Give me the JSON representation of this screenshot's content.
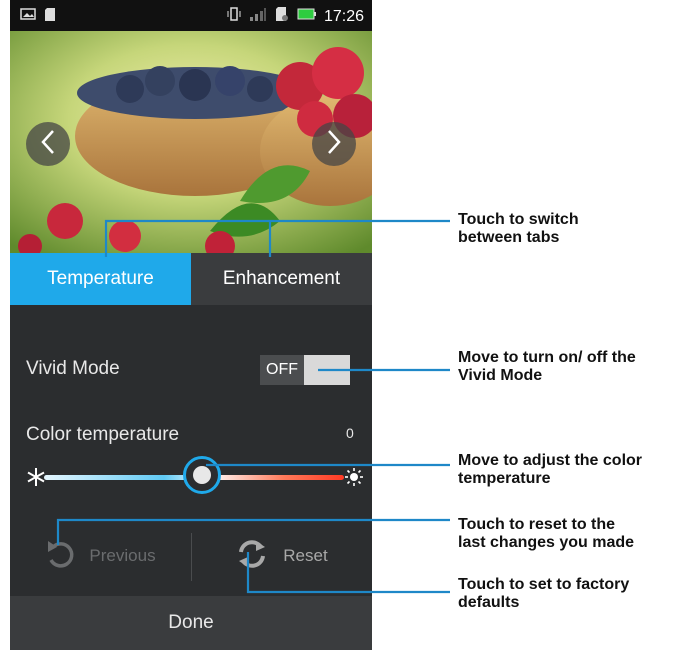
{
  "status_bar": {
    "time": "17:26",
    "icons": [
      "image-icon",
      "sd-card-icon",
      "vibrate-icon",
      "signal-icon",
      "sim-icon",
      "battery-icon"
    ]
  },
  "photo": {
    "prev_icon": "chevron-left-icon",
    "next_icon": "chevron-right-icon"
  },
  "tabs": [
    {
      "label": "Temperature",
      "active": true
    },
    {
      "label": "Enhancement",
      "active": false
    }
  ],
  "vivid_mode": {
    "label": "Vivid Mode",
    "state": "OFF"
  },
  "color_temperature": {
    "label": "Color temperature",
    "value": "0",
    "left_icon": "snowflake-icon",
    "right_icon": "sun-icon"
  },
  "actions": {
    "previous": "Previous",
    "reset": "Reset"
  },
  "done": "Done",
  "callouts": {
    "tabs": [
      "Touch to switch",
      "between tabs"
    ],
    "vivid": [
      "Move to turn on/ off the",
      "Vivid Mode"
    ],
    "temperature": [
      "Move to adjust the color",
      "temperature"
    ],
    "previous": [
      "Touch to reset to the",
      "last changes you made"
    ],
    "reset": [
      "Touch to set to factory",
      "defaults"
    ]
  },
  "colors": {
    "accent": "#1fa9ea",
    "panel": "#2b2d2f",
    "tab_inactive": "#3a3c3e"
  }
}
